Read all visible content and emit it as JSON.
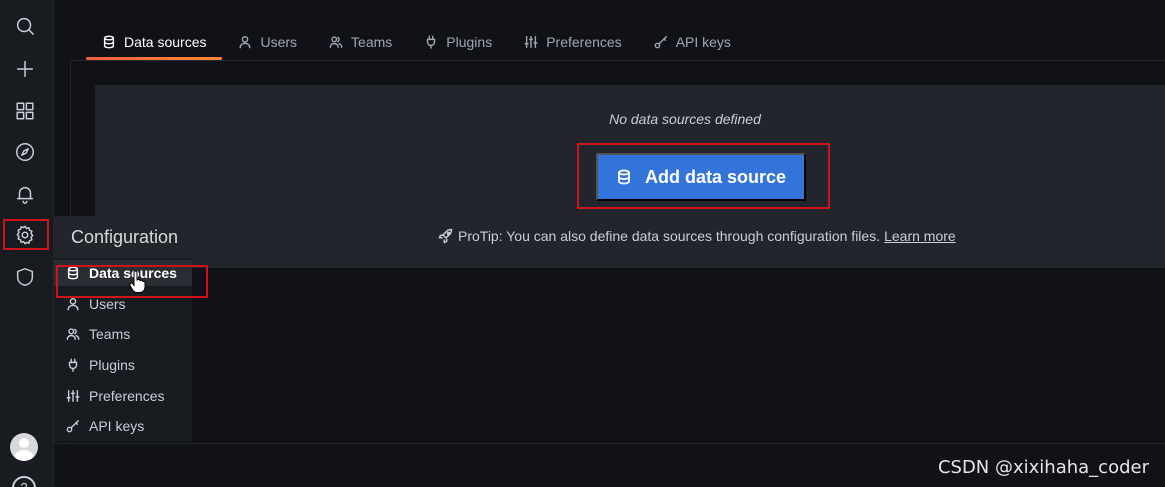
{
  "sidebar": {
    "icons": [
      "search-icon",
      "plus-icon",
      "dashboards-icon",
      "explore-icon",
      "alerting-icon",
      "gear-icon",
      "shield-icon",
      "avatar",
      "help-icon"
    ],
    "help_glyph": "?"
  },
  "flyout": {
    "title": "Configuration",
    "items": [
      {
        "label": "Data sources",
        "icon": "database-icon",
        "active": true
      },
      {
        "label": "Users",
        "icon": "user-icon"
      },
      {
        "label": "Teams",
        "icon": "users-icon"
      },
      {
        "label": "Plugins",
        "icon": "plug-icon"
      },
      {
        "label": "Preferences",
        "icon": "sliders-icon"
      },
      {
        "label": "API keys",
        "icon": "key-icon"
      }
    ]
  },
  "tabs": [
    {
      "label": "Data sources",
      "icon": "database-icon",
      "active": true
    },
    {
      "label": "Users",
      "icon": "user-icon"
    },
    {
      "label": "Teams",
      "icon": "users-icon"
    },
    {
      "label": "Plugins",
      "icon": "plug-icon"
    },
    {
      "label": "Preferences",
      "icon": "sliders-icon"
    },
    {
      "label": "API keys",
      "icon": "key-icon"
    }
  ],
  "main": {
    "empty_message": "No data sources defined",
    "add_button_label": "Add data source",
    "protip_text": "ProTip: You can also define data sources through configuration files.",
    "protip_link": "Learn more"
  },
  "watermark": "CSDN @xixihaha_coder",
  "colors": {
    "primary_button": "#3274d9",
    "active_tab_underline": "#f55f3e",
    "highlight_box": "#d0121b"
  }
}
